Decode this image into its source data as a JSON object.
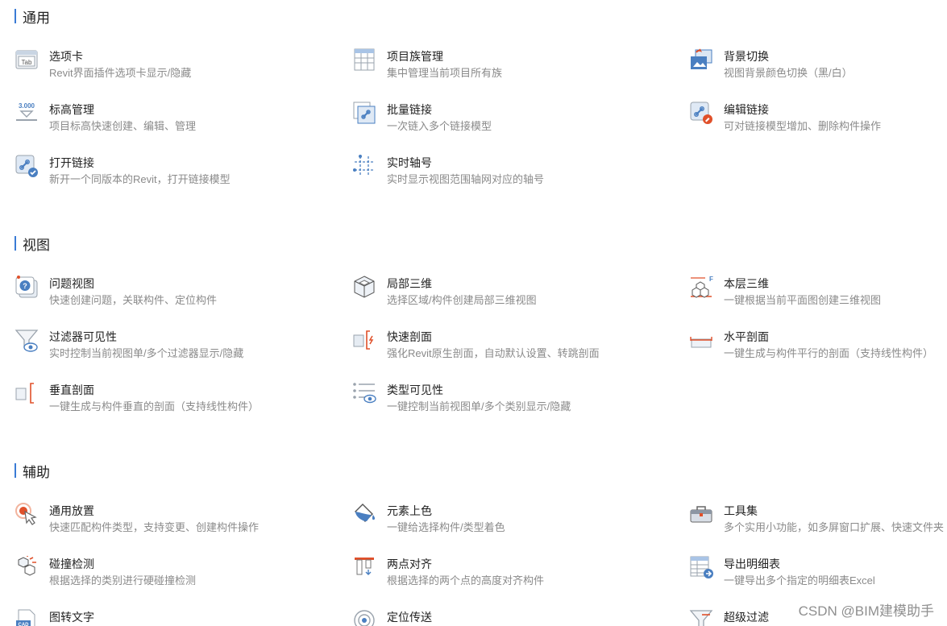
{
  "sections": [
    {
      "title": "通用",
      "items": [
        {
          "name": "选项卡",
          "desc": "Revit界面插件选项卡显示/隐藏"
        },
        {
          "name": "项目族管理",
          "desc": "集中管理当前项目所有族"
        },
        {
          "name": "背景切换",
          "desc": "视图背景颜色切换（黑/白）"
        },
        {
          "name": "标高管理",
          "desc": "项目标高快速创建、编辑、管理"
        },
        {
          "name": "批量链接",
          "desc": "一次链入多个链接模型"
        },
        {
          "name": "编辑链接",
          "desc": "可对链接模型增加、删除构件操作"
        },
        {
          "name": "打开链接",
          "desc": "新开一个同版本的Revit，打开链接模型"
        },
        {
          "name": "实时轴号",
          "desc": "实时显示视图范围轴网对应的轴号"
        }
      ]
    },
    {
      "title": "视图",
      "items": [
        {
          "name": "问题视图",
          "desc": "快速创建问题，关联构件、定位构件"
        },
        {
          "name": "局部三维",
          "desc": "选择区域/构件创建局部三维视图"
        },
        {
          "name": "本层三维",
          "desc": "一键根据当前平面图创建三维视图"
        },
        {
          "name": "过滤器可见性",
          "desc": "实时控制当前视图单/多个过滤器显示/隐藏"
        },
        {
          "name": "快速剖面",
          "desc": "强化Revit原生剖面，自动默认设置、转跳剖面"
        },
        {
          "name": "水平剖面",
          "desc": "一键生成与构件平行的剖面（支持线性构件）"
        },
        {
          "name": "垂直剖面",
          "desc": "一键生成与构件垂直的剖面（支持线性构件）"
        },
        {
          "name": "类型可见性",
          "desc": "一键控制当前视图单/多个类别显示/隐藏"
        }
      ]
    },
    {
      "title": "辅助",
      "items": [
        {
          "name": "通用放置",
          "desc": "快速匹配构件类型，支持变更、创建构件操作"
        },
        {
          "name": "元素上色",
          "desc": "一键给选择构件/类型着色"
        },
        {
          "name": "工具集",
          "desc": "多个实用小功能，如多屏窗口扩展、快速文件夹"
        },
        {
          "name": "碰撞检测",
          "desc": "根据选择的类别进行硬碰撞检测"
        },
        {
          "name": "两点对齐",
          "desc": "根据选择的两个点的高度对齐构件"
        },
        {
          "name": "导出明细表",
          "desc": "一键导出多个指定的明细表Excel"
        },
        {
          "name": "图转文字",
          "desc": ""
        },
        {
          "name": "定位传送",
          "desc": ""
        },
        {
          "name": "超级过滤",
          "desc": ""
        }
      ]
    }
  ],
  "icons": [
    [
      "tab-icon",
      "family-grid-icon",
      "background-switch-icon",
      "level-icon",
      "batch-link-icon",
      "edit-link-icon",
      "open-link-icon",
      "grid-axis-icon"
    ],
    [
      "issue-view-icon",
      "section-box-icon",
      "floor-3d-icon",
      "filter-visibility-icon",
      "quick-section-icon",
      "horizontal-section-icon",
      "vertical-section-icon",
      "type-visibility-icon"
    ],
    [
      "pointer-place-icon",
      "paint-bucket-icon",
      "toolbox-icon",
      "collision-cubes-icon",
      "align-points-icon",
      "export-schedule-icon",
      "image-to-text-icon",
      "locate-target-icon",
      "super-filter-icon"
    ]
  ],
  "icon_text": {
    "tab": "Tab",
    "level": "3.000",
    "floor": "F",
    "cad": "CAD"
  },
  "watermark": "CSDN @BIM建模助手",
  "colors": {
    "accent": "#3a7bd5",
    "icon_blue": "#4a7fc1",
    "icon_red": "#e0502a",
    "desc_gray": "#8a8a8a"
  }
}
